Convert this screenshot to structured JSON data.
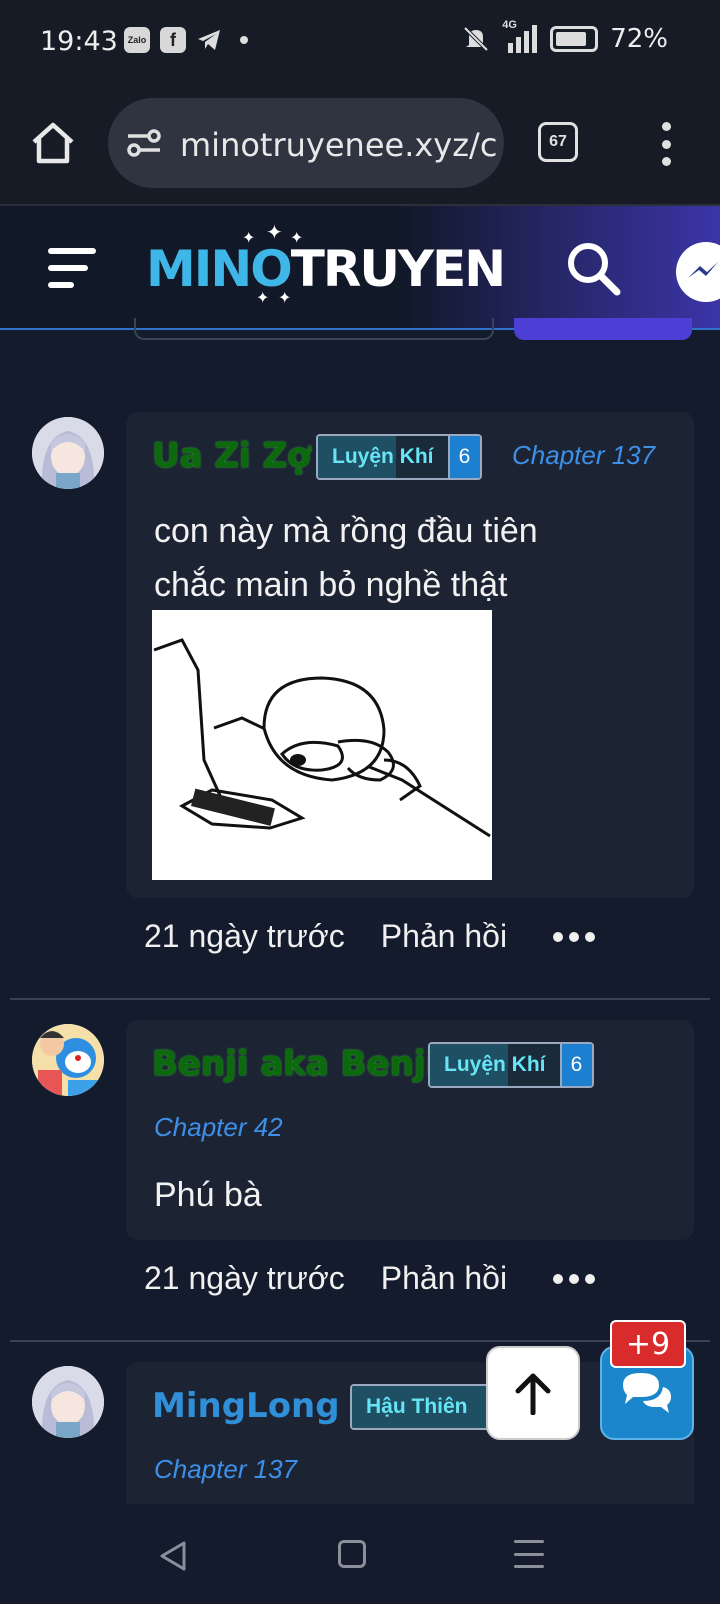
{
  "status_bar": {
    "time": "19:43",
    "left_icons": [
      "zalo-icon",
      "facebook-icon",
      "telegram-icon"
    ],
    "network": "4G",
    "battery": "72%"
  },
  "browser": {
    "url": "minotruyenee.xyz/c",
    "tab_count": "67"
  },
  "site": {
    "logo_part1": "MINO",
    "logo_part2": "TRUYEN",
    "accent": "#3fb6e8"
  },
  "comments": [
    {
      "username": "Ua Zi Zợ",
      "rank": "Luyện Khí",
      "level": "6",
      "chapter": "Chapter 137",
      "text_lines": [
        "con này mà rồng đầu tiên",
        "chắc main bỏ nghề thật"
      ],
      "time": "21 ngày trước",
      "reply": "Phản hồi"
    },
    {
      "username": "Benji aka Benji",
      "rank": "Luyện Khí",
      "level": "6",
      "chapter": "Chapter 42",
      "text_lines": [
        "Phú bà"
      ],
      "time": "21 ngày trước",
      "reply": "Phản hồi"
    },
    {
      "username": "MingLong",
      "rank": "Hậu Thiên",
      "chapter": "Chapter 137"
    }
  ],
  "floating": {
    "chat_badge": "+9"
  }
}
